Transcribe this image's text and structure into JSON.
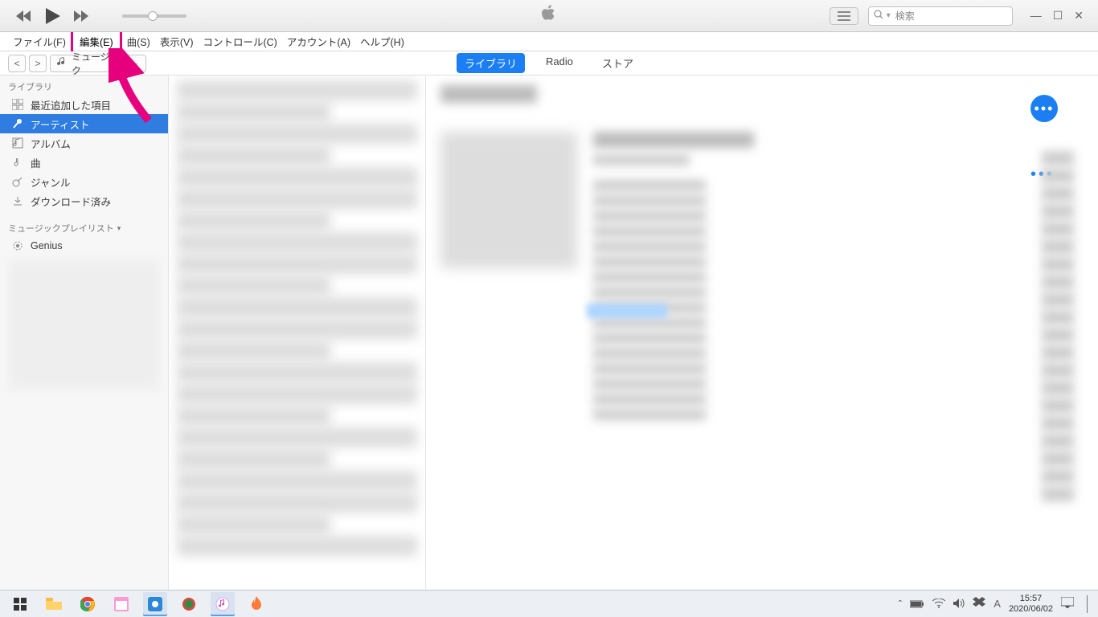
{
  "player": {
    "prev": "prev",
    "play": "play",
    "next": "next",
    "list_toggle": "list"
  },
  "search": {
    "placeholder": "検索",
    "icon": "search"
  },
  "window_buttons": {
    "min": "—",
    "max": "☐",
    "close": "✕"
  },
  "menubar": {
    "items": [
      {
        "label": "ファイル(F)"
      },
      {
        "label": "編集(E)",
        "highlighted": true
      },
      {
        "label": "曲(S)"
      },
      {
        "label": "表示(V)"
      },
      {
        "label": "コントロール(C)"
      },
      {
        "label": "アカウント(A)"
      },
      {
        "label": "ヘルプ(H)"
      }
    ]
  },
  "subnav": {
    "back": "<",
    "fwd": ">",
    "media_label": "ミュージック",
    "tabs": [
      {
        "label": "ライブラリ",
        "active": true
      },
      {
        "label": "Radio"
      },
      {
        "label": "ストア"
      }
    ]
  },
  "sidebar": {
    "section_label": "ライブラリ",
    "items": [
      {
        "label": "最近追加した項目",
        "icon": "grid"
      },
      {
        "label": "アーティスト",
        "icon": "mic",
        "active": true
      },
      {
        "label": "アルバム",
        "icon": "album"
      },
      {
        "label": "曲",
        "icon": "note"
      },
      {
        "label": "ジャンル",
        "icon": "guitar"
      },
      {
        "label": "ダウンロード済み",
        "icon": "download"
      }
    ],
    "playlist_label": "ミュージックプレイリスト",
    "playlist_item": "Genius"
  },
  "taskbar": {
    "clock_time": "15:57",
    "clock_date": "2020/06/02",
    "ime_label": "A"
  },
  "colors": {
    "accent": "#1b7ff3",
    "annotation": "#e6007e"
  }
}
